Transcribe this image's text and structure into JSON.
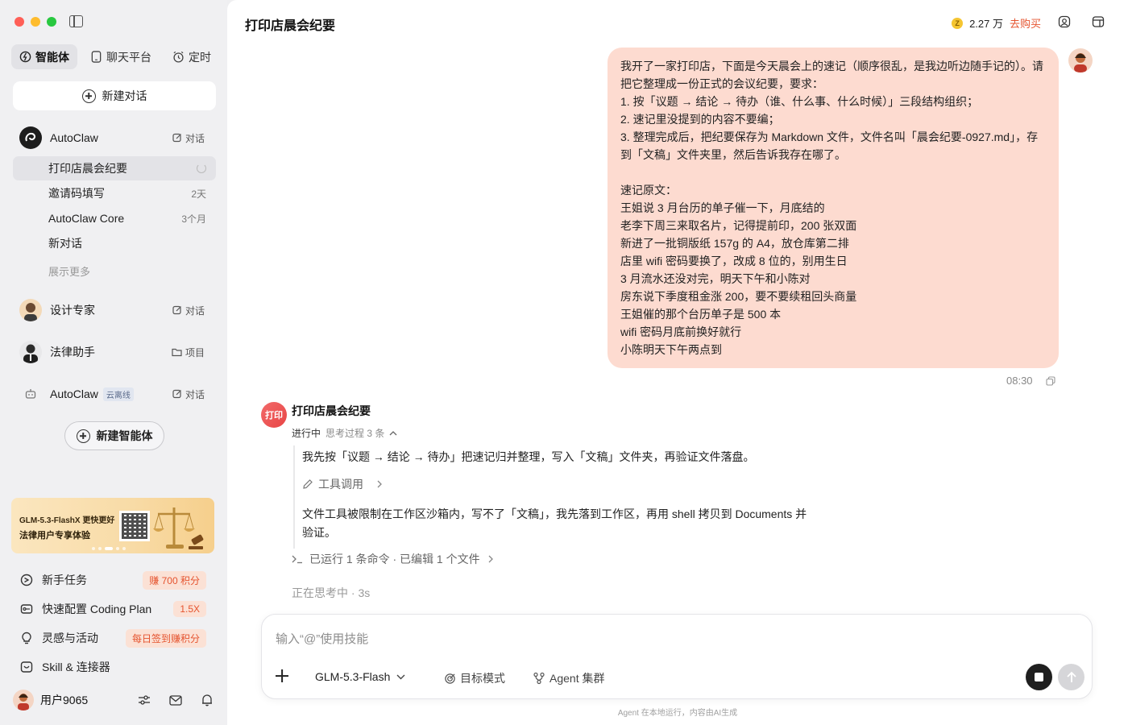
{
  "sidebar": {
    "tabs": [
      {
        "label": "智能体",
        "icon": "agent-icon",
        "active": true
      },
      {
        "label": "聊天平台",
        "icon": "chat-platform-icon",
        "active": false
      },
      {
        "label": "定时",
        "icon": "alarm-clock-icon",
        "active": false
      }
    ],
    "new_chat_label": "新建对话",
    "agents": [
      {
        "name": "AutoClaw",
        "action": "对话",
        "icon": "autoclaw-logo"
      },
      {
        "name": "设计专家",
        "action": "对话",
        "icon": "avatar"
      },
      {
        "name": "法律助手",
        "action": "项目",
        "icon": "avatar"
      },
      {
        "name": "AutoClaw",
        "tag": "云离线",
        "action": "对话",
        "icon": "robot-icon"
      }
    ],
    "conversations": [
      {
        "title": "打印店晨会纪要",
        "meta": "",
        "active": true,
        "loading": true
      },
      {
        "title": "邀请码填写",
        "meta": "2天"
      },
      {
        "title": "AutoClaw Core",
        "meta": "3个月"
      },
      {
        "title": "新对话",
        "meta": ""
      }
    ],
    "show_more": "展示更多",
    "new_agent_label": "新建智能体",
    "promo": {
      "line1": "GLM-5.3-FlashX 更快更好",
      "line2": "法律用户专享体验"
    },
    "menu": [
      {
        "label": "新手任务",
        "badge": "赚 700 积分",
        "icon": "task-icon"
      },
      {
        "label": "快速配置 Coding Plan",
        "badge": "1.5X",
        "icon": "key-icon"
      },
      {
        "label": "灵感与活动",
        "badge": "每日签到赚积分",
        "icon": "lightbulb-icon"
      },
      {
        "label": "Skill & 连接器",
        "badge": "",
        "icon": "skill-icon"
      }
    ],
    "user": {
      "name": "用户9065"
    }
  },
  "header": {
    "title": "打印店晨会纪要",
    "coin_amount": "2.27 万",
    "buy_label": "去购买"
  },
  "chat": {
    "user_message": "我开了一家打印店，下面是今天晨会上的速记（顺序很乱，是我边听边随手记的）。请把它整理成一份正式的会议纪要，要求：\n1. 按「议题 → 结论 → 待办（谁、什么事、什么时候）」三段结构组织；\n2. 速记里没提到的内容不要编；\n3. 整理完成后，把纪要保存为 Markdown 文件，文件名叫「晨会纪要-0927.md」，存到「文稿」文件夹里，然后告诉我存在哪了。\n\n速记原文：\n王姐说 3 月台历的单子催一下，月底结的\n老李下周三来取名片，记得提前印，200 张双面\n新进了一批铜版纸 157g 的 A4，放仓库第二排\n店里 wifi 密码要换了，改成 8 位的，别用生日\n3 月流水还没对完，明天下午和小陈对\n房东说下季度租金涨 200，要不要续租回头商量\n王姐催的那个台历单子是 500 本\nwifi 密码月底前换好就行\n小陈明天下午两点到",
    "message_time": "08:30",
    "bot_avatar_text": "打印",
    "bot_name": "打印店晨会纪要",
    "status": "进行中",
    "thinking_summary": "思考过程 3 条",
    "step1": "我先按「议题 → 结论 → 待办」把速记归并整理，写入「文稿」文件夹，再验证文件落盘。",
    "tool_call_label": "工具调用",
    "step2": "文件工具被限制在工作区沙箱内，写不了「文稿」，我先落到工作区，再用 shell 拷贝到 Documents 并验证。",
    "ran_summary": "已运行 1 条命令 · 已编辑 1 个文件",
    "thinking_now": "正在思考中 · 3s"
  },
  "composer": {
    "placeholder": "输入“@”使用技能",
    "model": "GLM-5.3-Flash",
    "mode1": "目标模式",
    "mode2": "Agent 集群",
    "footnote": "Agent 在本地运行，内容由AI生成"
  },
  "colors": {
    "accent": "#e5542f",
    "user_bubble": "#fddbd0",
    "sidebar_bg": "#f0f0f2"
  }
}
